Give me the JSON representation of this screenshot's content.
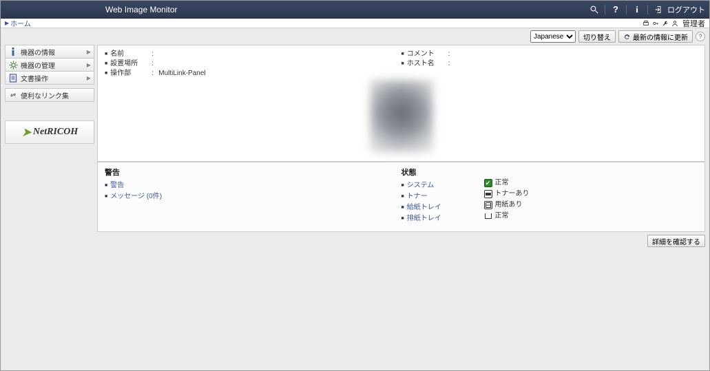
{
  "header": {
    "title": "Web Image Monitor",
    "logout_label": "ログアウト"
  },
  "breadcrumb": {
    "home": "ホーム"
  },
  "userrow": {
    "role": "管理者"
  },
  "toolbar": {
    "language_options": [
      "Japanese"
    ],
    "language_selected": "Japanese",
    "switch_label": "切り替え",
    "refresh_label": "最新の情報に更新"
  },
  "sidebar": {
    "items": [
      {
        "label": "機器の情報"
      },
      {
        "label": "機器の管理"
      },
      {
        "label": "文書操作"
      },
      {
        "label": "便利なリンク集"
      }
    ],
    "logo_text": "NetRICOH"
  },
  "info": {
    "left": [
      {
        "key": "名前",
        "val": ""
      },
      {
        "key": "設置場所",
        "val": ""
      },
      {
        "key": "操作部",
        "val": "MultiLink-Panel"
      }
    ],
    "right": [
      {
        "key": "コメント",
        "val": ""
      },
      {
        "key": "ホスト名",
        "val": ""
      }
    ]
  },
  "alerts": {
    "title": "警告",
    "items": [
      {
        "label": "警告"
      },
      {
        "label": "メッセージ (0件)"
      }
    ]
  },
  "status": {
    "title": "状態",
    "items": [
      {
        "label": "システム"
      },
      {
        "label": "トナー"
      },
      {
        "label": "給紙トレイ"
      },
      {
        "label": "排紙トレイ"
      }
    ],
    "states": [
      {
        "label": "正常",
        "icon": "ok"
      },
      {
        "label": "トナーあり",
        "icon": "toner"
      },
      {
        "label": "用紙あり",
        "icon": "paper"
      },
      {
        "label": "正常",
        "icon": "tray"
      }
    ]
  },
  "footer": {
    "details_label": "詳細を確認する"
  }
}
